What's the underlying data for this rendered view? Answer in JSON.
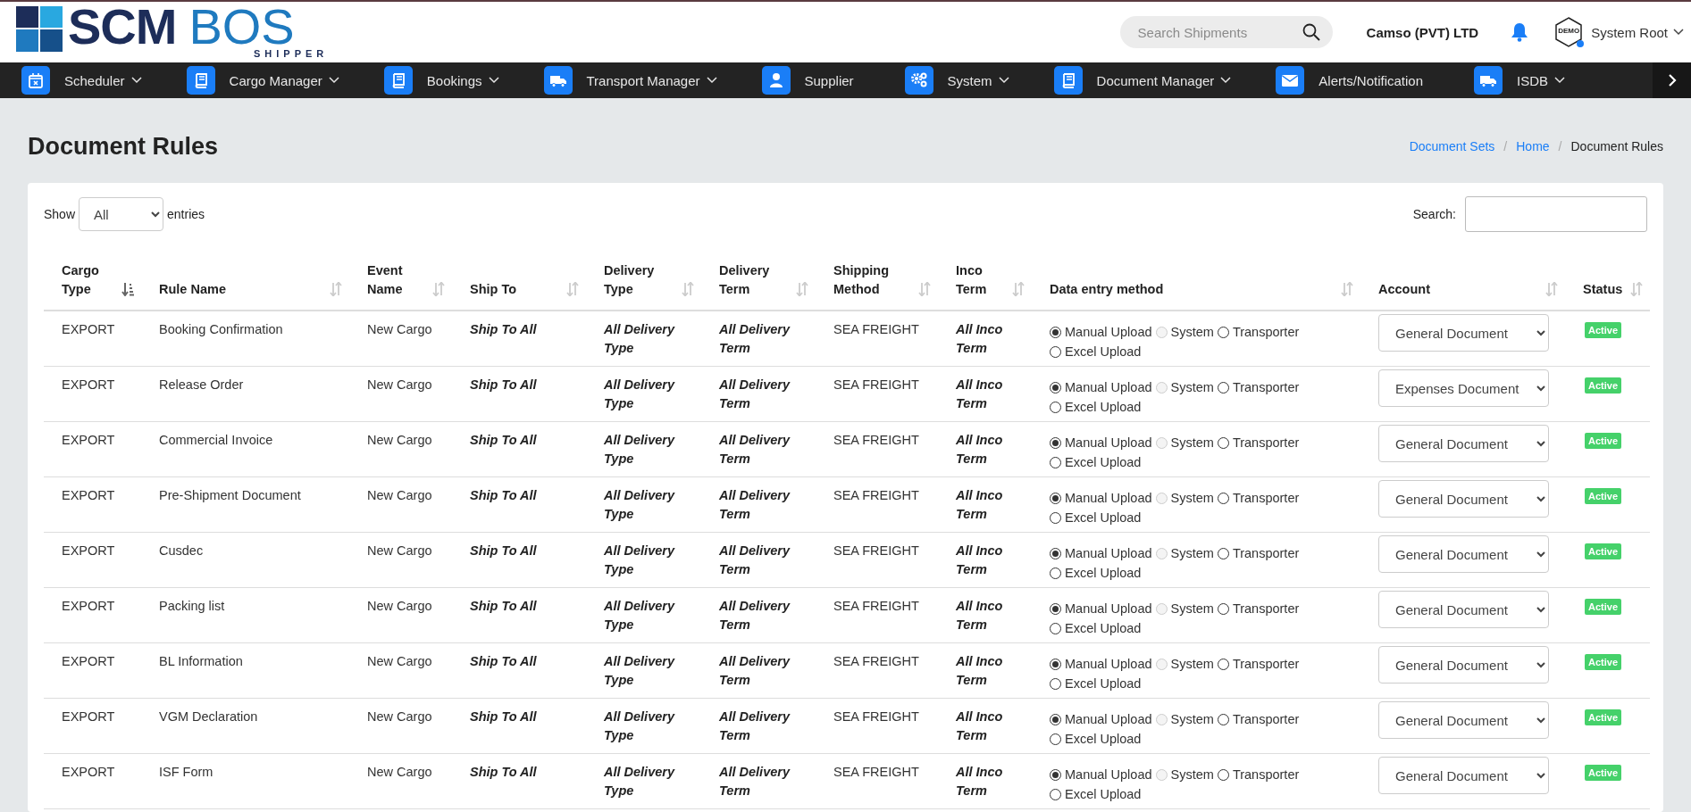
{
  "logo": {
    "primary": "SCM",
    "secondary": "BOS",
    "tagline": "SHIPPER"
  },
  "header": {
    "search": {
      "placeholder": "Search Shipments"
    },
    "company": "Camso (PVT) LTD",
    "avatar_text": "DEMO",
    "user": "System Root"
  },
  "nav": {
    "items": [
      {
        "label": "Scheduler",
        "dropdown": true
      },
      {
        "label": "Cargo Manager",
        "dropdown": true
      },
      {
        "label": "Bookings",
        "dropdown": true
      },
      {
        "label": "Transport Manager",
        "dropdown": true
      },
      {
        "label": "Supplier",
        "dropdown": false
      },
      {
        "label": "System",
        "dropdown": true
      },
      {
        "label": "Document Manager",
        "dropdown": true
      },
      {
        "label": "Alerts/Notification",
        "dropdown": false
      },
      {
        "label": "ISDB",
        "dropdown": true
      }
    ]
  },
  "page": {
    "title": "Document Rules",
    "breadcrumb": [
      {
        "label": "Document Sets",
        "link": true
      },
      {
        "label": "Home",
        "link": true,
        "separator": "/"
      },
      {
        "label": "Document Rules",
        "link": false,
        "separator": "/"
      }
    ]
  },
  "table_controls": {
    "show_label": "Show",
    "length_value": "All",
    "entries_label": "entries",
    "search_label": "Search:"
  },
  "table": {
    "columns": [
      {
        "label": "Cargo Type",
        "sorted": true
      },
      {
        "label": "Rule Name",
        "sorted": false
      },
      {
        "label": "Event Name",
        "sorted": false
      },
      {
        "label": "Ship To",
        "sorted": false
      },
      {
        "label": "Delivery Type",
        "sorted": false
      },
      {
        "label": "Delivery Term",
        "sorted": false
      },
      {
        "label": "Shipping Method",
        "sorted": false
      },
      {
        "label": "Inco Term",
        "sorted": false
      },
      {
        "label": "Data entry method",
        "sorted": false
      },
      {
        "label": "Account",
        "sorted": false
      },
      {
        "label": "Status",
        "sorted": false
      }
    ],
    "rows": [
      {
        "cargo_type": "EXPORT",
        "rule_name": "Booking Confirmation",
        "event_name": "New Cargo",
        "ship_to": "Ship To All",
        "delivery_type": "All Delivery Type",
        "delivery_term": "All Delivery Term",
        "shipping_method": "SEA FREIGHT",
        "inco_term": "All Inco Term",
        "data_entry_methods": [
          {
            "label": "Manual Upload",
            "selected": true,
            "disabled": false
          },
          {
            "label": "System",
            "selected": false,
            "disabled": true
          },
          {
            "label": "Transporter",
            "selected": false,
            "disabled": false
          },
          {
            "label": "Excel Upload",
            "selected": false,
            "disabled": false
          }
        ],
        "account": "General Document",
        "status": "Active"
      },
      {
        "cargo_type": "EXPORT",
        "rule_name": "Release Order",
        "event_name": "New Cargo",
        "ship_to": "Ship To All",
        "delivery_type": "All Delivery Type",
        "delivery_term": "All Delivery Term",
        "shipping_method": "SEA FREIGHT",
        "inco_term": "All Inco Term",
        "data_entry_methods": [
          {
            "label": "Manual Upload",
            "selected": true,
            "disabled": false
          },
          {
            "label": "System",
            "selected": false,
            "disabled": true
          },
          {
            "label": "Transporter",
            "selected": false,
            "disabled": false
          },
          {
            "label": "Excel Upload",
            "selected": false,
            "disabled": false
          }
        ],
        "account": "Expenses Document",
        "status": "Active"
      },
      {
        "cargo_type": "EXPORT",
        "rule_name": "Commercial Invoice",
        "event_name": "New Cargo",
        "ship_to": "Ship To All",
        "delivery_type": "All Delivery Type",
        "delivery_term": "All Delivery Term",
        "shipping_method": "SEA FREIGHT",
        "inco_term": "All Inco Term",
        "data_entry_methods": [
          {
            "label": "Manual Upload",
            "selected": true,
            "disabled": false
          },
          {
            "label": "System",
            "selected": false,
            "disabled": true
          },
          {
            "label": "Transporter",
            "selected": false,
            "disabled": false
          },
          {
            "label": "Excel Upload",
            "selected": false,
            "disabled": false
          }
        ],
        "account": "General Document",
        "status": "Active"
      },
      {
        "cargo_type": "EXPORT",
        "rule_name": "Pre-Shipment Document",
        "event_name": "New Cargo",
        "ship_to": "Ship To All",
        "delivery_type": "All Delivery Type",
        "delivery_term": "All Delivery Term",
        "shipping_method": "SEA FREIGHT",
        "inco_term": "All Inco Term",
        "data_entry_methods": [
          {
            "label": "Manual Upload",
            "selected": true,
            "disabled": false
          },
          {
            "label": "System",
            "selected": false,
            "disabled": true
          },
          {
            "label": "Transporter",
            "selected": false,
            "disabled": false
          },
          {
            "label": "Excel Upload",
            "selected": false,
            "disabled": false
          }
        ],
        "account": "General Document",
        "status": "Active"
      },
      {
        "cargo_type": "EXPORT",
        "rule_name": "Cusdec",
        "event_name": "New Cargo",
        "ship_to": "Ship To All",
        "delivery_type": "All Delivery Type",
        "delivery_term": "All Delivery Term",
        "shipping_method": "SEA FREIGHT",
        "inco_term": "All Inco Term",
        "data_entry_methods": [
          {
            "label": "Manual Upload",
            "selected": true,
            "disabled": false
          },
          {
            "label": "System",
            "selected": false,
            "disabled": true
          },
          {
            "label": "Transporter",
            "selected": false,
            "disabled": false
          },
          {
            "label": "Excel Upload",
            "selected": false,
            "disabled": false
          }
        ],
        "account": "General Document",
        "status": "Active"
      },
      {
        "cargo_type": "EXPORT",
        "rule_name": "Packing list",
        "event_name": "New Cargo",
        "ship_to": "Ship To All",
        "delivery_type": "All Delivery Type",
        "delivery_term": "All Delivery Term",
        "shipping_method": "SEA FREIGHT",
        "inco_term": "All Inco Term",
        "data_entry_methods": [
          {
            "label": "Manual Upload",
            "selected": true,
            "disabled": false
          },
          {
            "label": "System",
            "selected": false,
            "disabled": true
          },
          {
            "label": "Transporter",
            "selected": false,
            "disabled": false
          },
          {
            "label": "Excel Upload",
            "selected": false,
            "disabled": false
          }
        ],
        "account": "General Document",
        "status": "Active"
      },
      {
        "cargo_type": "EXPORT",
        "rule_name": "BL Information",
        "event_name": "New Cargo",
        "ship_to": "Ship To All",
        "delivery_type": "All Delivery Type",
        "delivery_term": "All Delivery Term",
        "shipping_method": "SEA FREIGHT",
        "inco_term": "All Inco Term",
        "data_entry_methods": [
          {
            "label": "Manual Upload",
            "selected": true,
            "disabled": false
          },
          {
            "label": "System",
            "selected": false,
            "disabled": true
          },
          {
            "label": "Transporter",
            "selected": false,
            "disabled": false
          },
          {
            "label": "Excel Upload",
            "selected": false,
            "disabled": false
          }
        ],
        "account": "General Document",
        "status": "Active"
      },
      {
        "cargo_type": "EXPORT",
        "rule_name": "VGM Declaration",
        "event_name": "New Cargo",
        "ship_to": "Ship To All",
        "delivery_type": "All Delivery Type",
        "delivery_term": "All Delivery Term",
        "shipping_method": "SEA FREIGHT",
        "inco_term": "All Inco Term",
        "data_entry_methods": [
          {
            "label": "Manual Upload",
            "selected": true,
            "disabled": false
          },
          {
            "label": "System",
            "selected": false,
            "disabled": true
          },
          {
            "label": "Transporter",
            "selected": false,
            "disabled": false
          },
          {
            "label": "Excel Upload",
            "selected": false,
            "disabled": false
          }
        ],
        "account": "General Document",
        "status": "Active"
      },
      {
        "cargo_type": "EXPORT",
        "rule_name": "ISF Form",
        "event_name": "New Cargo",
        "ship_to": "Ship To All",
        "delivery_type": "All Delivery Type",
        "delivery_term": "All Delivery Term",
        "shipping_method": "SEA FREIGHT",
        "inco_term": "All Inco Term",
        "data_entry_methods": [
          {
            "label": "Manual Upload",
            "selected": true,
            "disabled": false
          },
          {
            "label": "System",
            "selected": false,
            "disabled": true
          },
          {
            "label": "Transporter",
            "selected": false,
            "disabled": false
          },
          {
            "label": "Excel Upload",
            "selected": false,
            "disabled": false
          }
        ],
        "account": "General Document",
        "status": "Active"
      }
    ]
  }
}
